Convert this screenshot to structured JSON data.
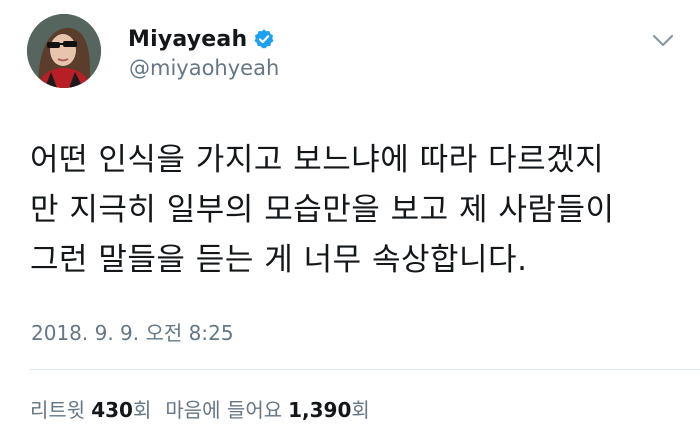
{
  "user": {
    "display_name": "Miyayeah",
    "handle": "@miyaohyeah",
    "verified": true
  },
  "tweet": {
    "lines": [
      "어떤 인식을 가지고 보느냐에 따라 다르겠지",
      "만 지극히 일부의 모습만을 보고 제 사람들이",
      "그런 말들을 듣는 게 너무 속상합니다."
    ],
    "timestamp": "2018. 9. 9. 오전 8:25"
  },
  "stats": {
    "retweets_label": "리트윗",
    "retweets_count": "430",
    "retweets_unit": "회",
    "likes_label": "마음에 들어요",
    "likes_count": "1,390",
    "likes_unit": "회"
  },
  "icons": {
    "verified": "verified-badge-icon",
    "menu": "chevron-down-icon"
  },
  "colors": {
    "accent": "#1da1f2",
    "text": "#14171a",
    "muted": "#657786",
    "divider": "#e1e8ed"
  }
}
